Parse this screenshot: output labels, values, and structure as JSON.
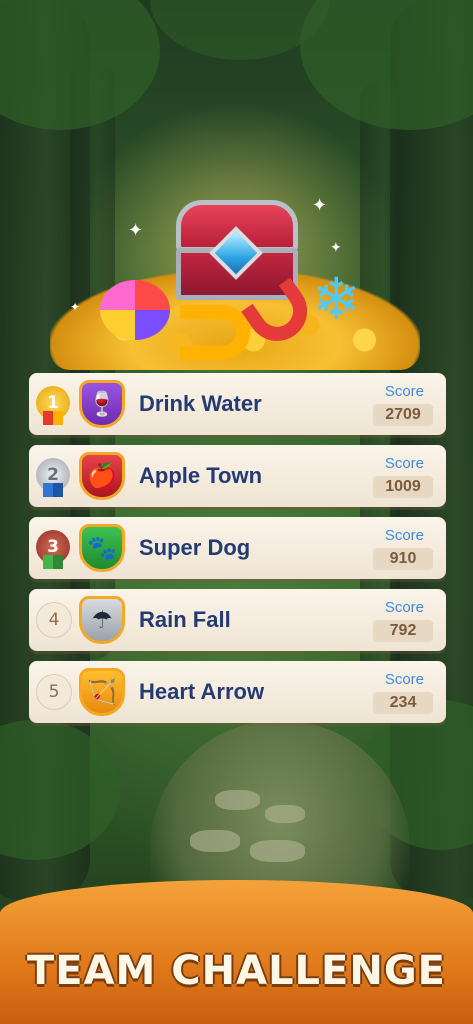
{
  "leaderboard": {
    "score_label": "Score",
    "entries": [
      {
        "rank": "1",
        "name": "Drink Water",
        "score": "2709",
        "medal": "gold",
        "icon": "drink-icon",
        "glyph": "🍷"
      },
      {
        "rank": "2",
        "name": "Apple Town",
        "score": "1009",
        "medal": "silver",
        "icon": "apple-icon",
        "glyph": "🍎"
      },
      {
        "rank": "3",
        "name": "Super Dog",
        "score": "910",
        "medal": "bronze",
        "icon": "paw-icon",
        "glyph": "🐾"
      },
      {
        "rank": "4",
        "name": "Rain Fall",
        "score": "792",
        "medal": "plain",
        "icon": "umbrella-icon",
        "glyph": "☂"
      },
      {
        "rank": "5",
        "name": "Heart Arrow",
        "score": "234",
        "medal": "plain",
        "icon": "bow-arrow-icon",
        "glyph": "🏹"
      }
    ]
  },
  "footer": {
    "title": "TEAM CHALLENGE"
  },
  "colors": {
    "accent": "#f5a23a",
    "name_text": "#233a73",
    "score_label": "#3f8ae0"
  }
}
